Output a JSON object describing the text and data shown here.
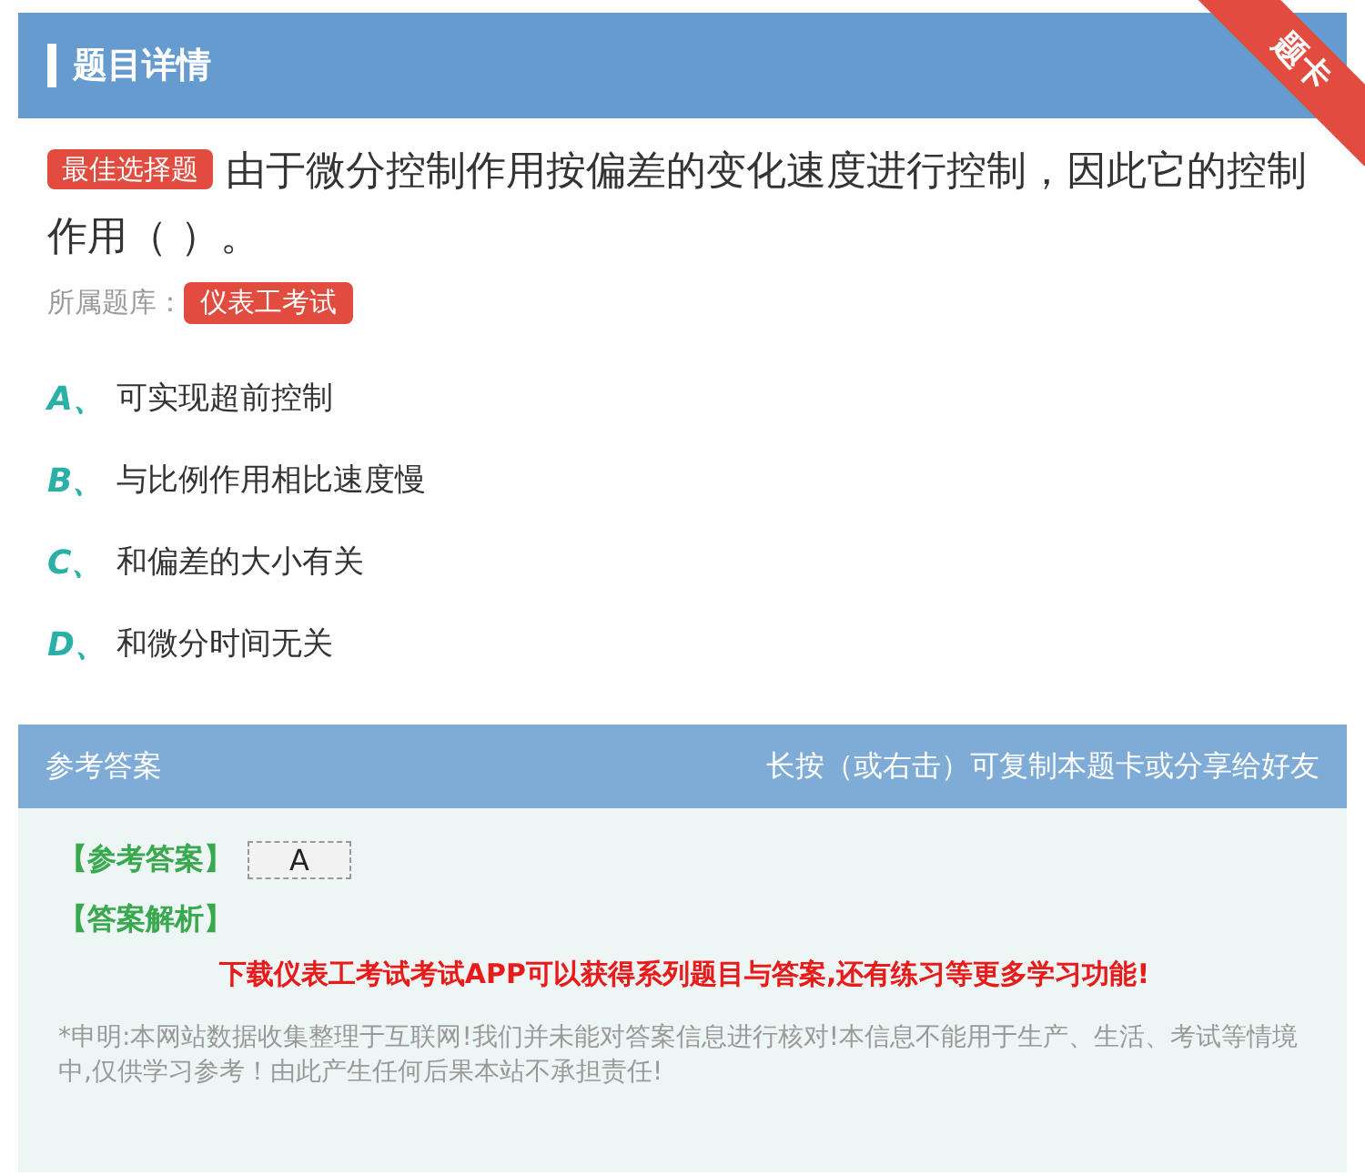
{
  "header": {
    "title": "题目详情",
    "ribbon": "题卡"
  },
  "question": {
    "type_tag": "最佳选择题",
    "text": "由于微分控制作用按偏差的变化速度进行控制，因此它的控制作用（ ）。",
    "bank_label": "所属题库：",
    "bank": "仪表工考试"
  },
  "options": [
    {
      "letter": "A、",
      "text": "可实现超前控制"
    },
    {
      "letter": "B、",
      "text": "与比例作用相比速度慢"
    },
    {
      "letter": "C、",
      "text": "和偏差的大小有关"
    },
    {
      "letter": "D、",
      "text": "和微分时间无关"
    }
  ],
  "answer_section": {
    "title": "参考答案",
    "hint": "长按（或右击）可复制本题卡或分享给好友",
    "answer_label": "【参考答案】",
    "answer": "A",
    "analysis_label": "【答案解析】",
    "promo": "下载仪表工考试考试APP可以获得系列题目与答案,还有练习等更多学习功能!",
    "disclaimer": "*申明:本网站数据收集整理于互联网!我们并未能对答案信息进行核对!本信息不能用于生产、生活、考试等情境中,仅供学习参考！由此产生任何后果本站不承担责任!"
  }
}
